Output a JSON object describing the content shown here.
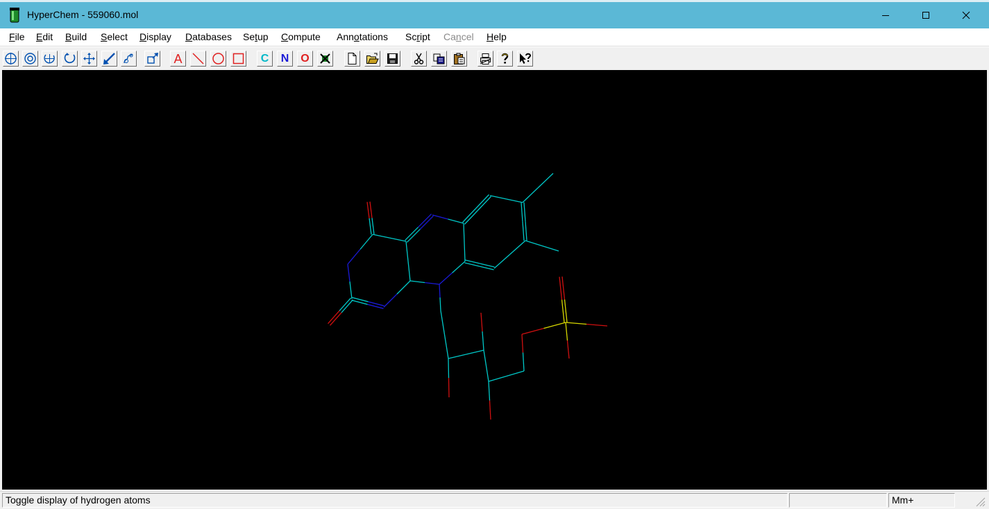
{
  "window": {
    "title": "HyperChem - 559060.mol"
  },
  "menu": {
    "items": [
      {
        "label": "File",
        "enabled": true
      },
      {
        "label": "Edit",
        "enabled": true
      },
      {
        "label": "Build",
        "enabled": true
      },
      {
        "label": "Select",
        "enabled": true
      },
      {
        "label": "Display",
        "enabled": true
      },
      {
        "label": "Databases",
        "enabled": true
      },
      {
        "label": "Setup",
        "enabled": true
      },
      {
        "label": "Compute",
        "enabled": true
      },
      {
        "label": "Annotations",
        "enabled": true
      },
      {
        "label": "Script",
        "enabled": true
      },
      {
        "label": "Cancel",
        "enabled": false
      },
      {
        "label": "Help",
        "enabled": true
      }
    ]
  },
  "toolbar": {
    "tools": [
      "draw-tool",
      "select-tool",
      "rotate-out-of-plane-tool",
      "rotate-in-plane-tool",
      "translate-tool",
      "z-translate-tool",
      "zoom-tool",
      "z-clip-tool",
      "text-annotation-tool",
      "line-annotation-tool",
      "ellipse-annotation-tool",
      "rectangle-annotation-tool",
      "carbon-element",
      "nitrogen-element",
      "oxygen-element",
      "periodic-table",
      "new-file",
      "open-file",
      "save-file",
      "cut",
      "copy",
      "paste",
      "print",
      "help",
      "context-help"
    ],
    "carbon_label": "C",
    "nitrogen_label": "N",
    "oxygen_label": "O",
    "text_tool_label": "A"
  },
  "molecule": {
    "colors": {
      "carbon": "#00c8c8",
      "nitrogen": "#1a1ad6",
      "oxygen": "#d01010",
      "sulfur": "#d8d800"
    }
  },
  "status": {
    "message": "Toggle display of hydrogen atoms",
    "panel2": "",
    "mode": "Mm+"
  }
}
